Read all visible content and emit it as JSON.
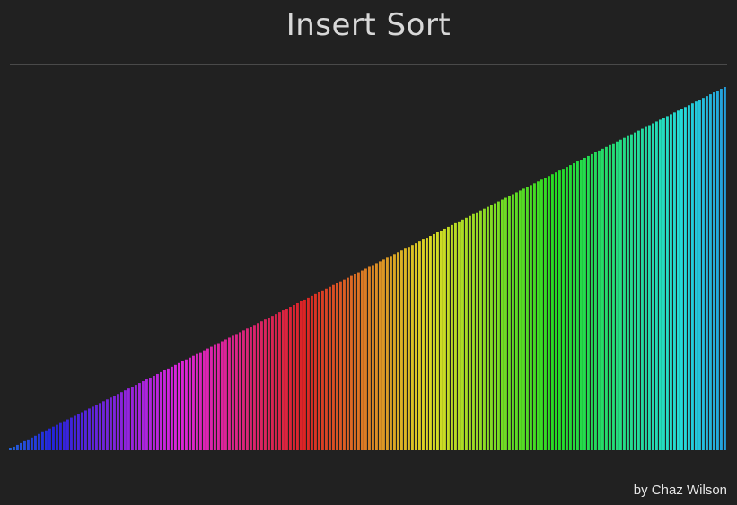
{
  "header": {
    "title": "Insert Sort"
  },
  "footer": {
    "credit": "by Chaz Wilson"
  },
  "chart_data": {
    "type": "bar",
    "count": 200,
    "values_description": "sorted ascending, linearly increasing from 1 to 200",
    "min": 1,
    "max": 200,
    "color_scale": "rainbow hue by value (blue → purple → red → orange → yellow → green → teal)",
    "background": "#212121"
  }
}
